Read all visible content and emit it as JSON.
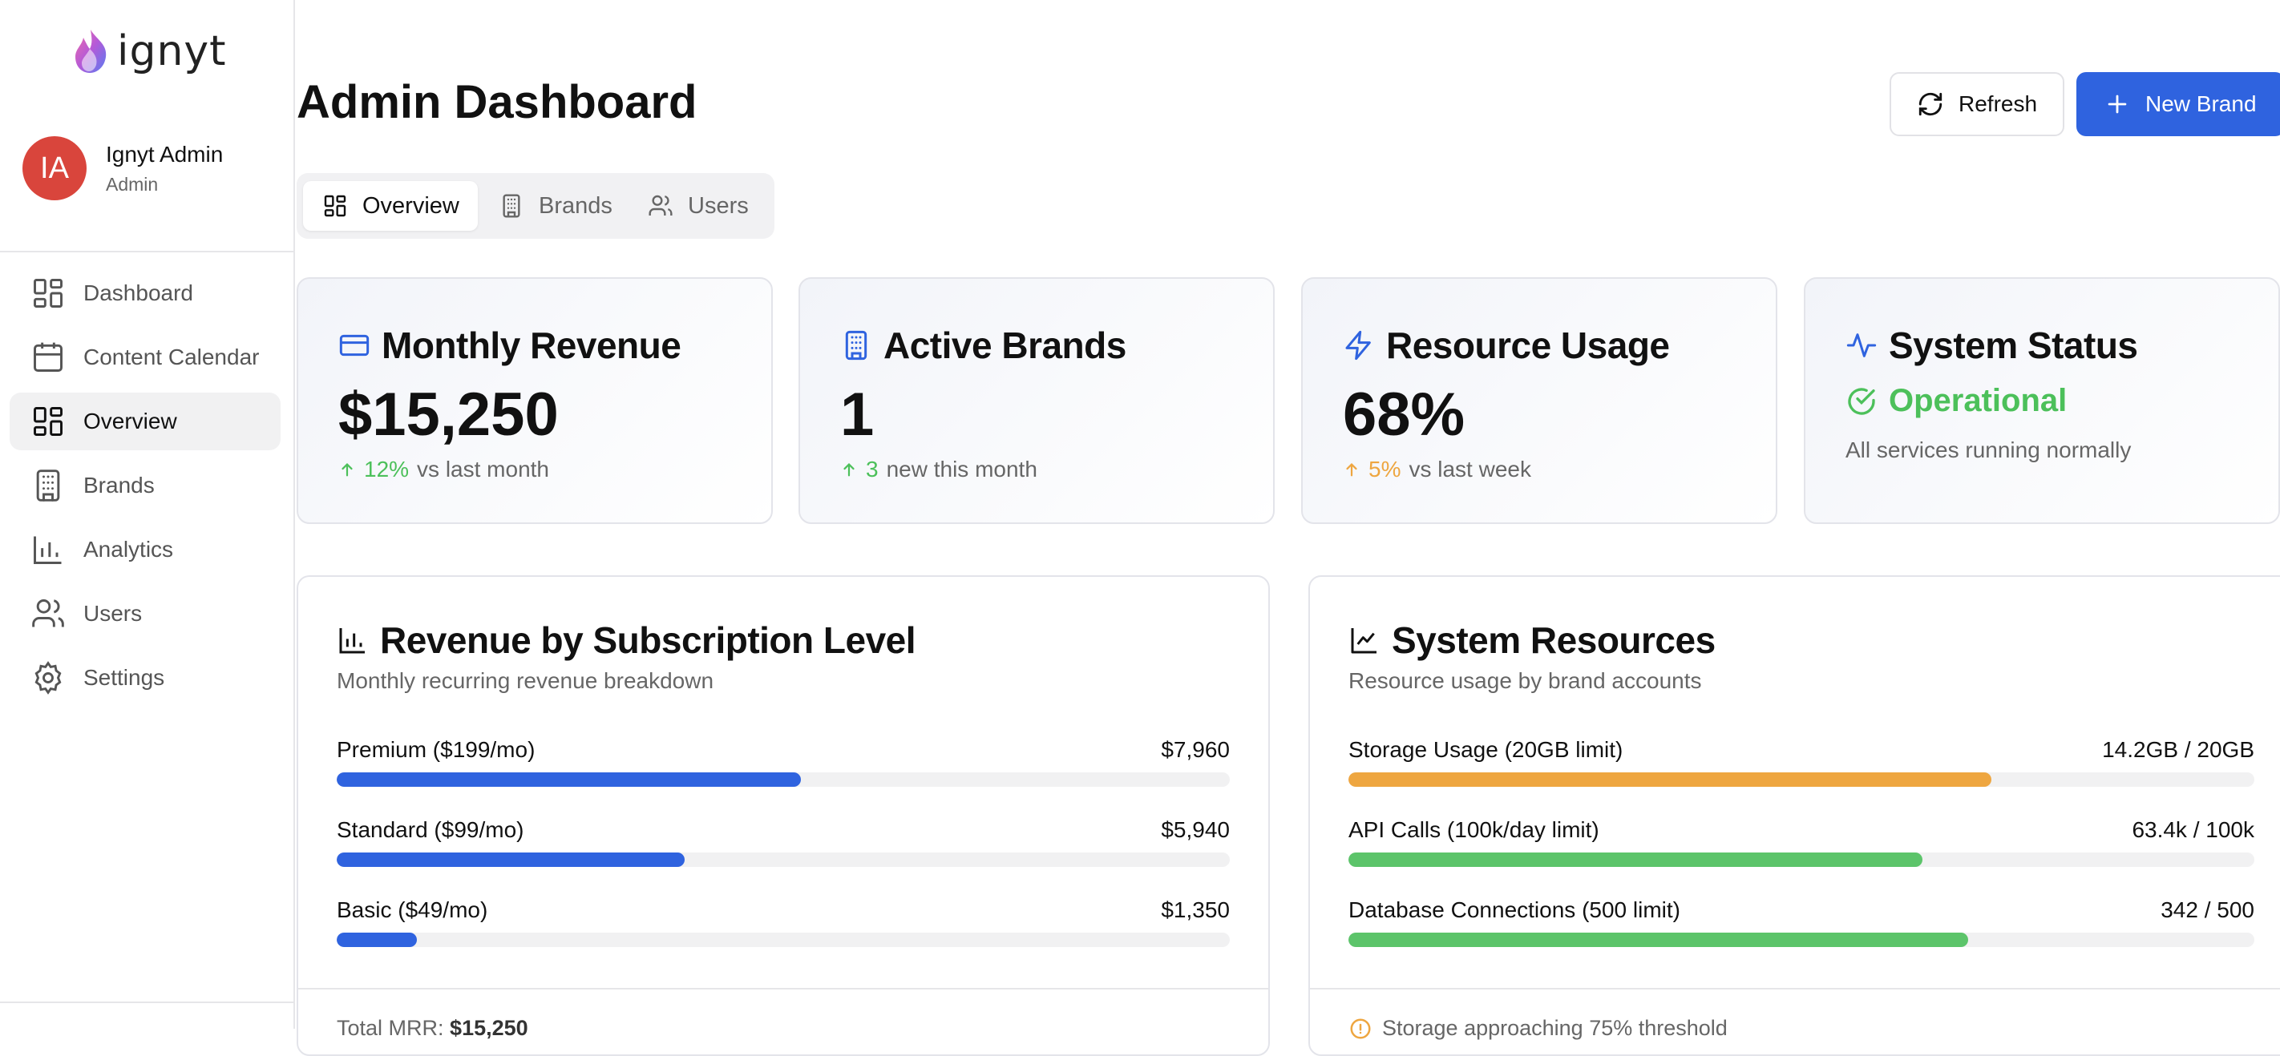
{
  "brand": {
    "name": "ignyt"
  },
  "user": {
    "initials": "IA",
    "name": "Ignyt Admin",
    "role": "Admin"
  },
  "nav": [
    {
      "label": "Dashboard",
      "icon": "dashboard-icon",
      "active": false
    },
    {
      "label": "Content Calendar",
      "icon": "calendar-icon",
      "active": false
    },
    {
      "label": "Overview",
      "icon": "dashboard-icon",
      "active": true
    },
    {
      "label": "Brands",
      "icon": "building-icon",
      "active": false
    },
    {
      "label": "Analytics",
      "icon": "bar-chart-icon",
      "active": false
    },
    {
      "label": "Users",
      "icon": "users-icon",
      "active": false
    },
    {
      "label": "Settings",
      "icon": "gear-icon",
      "active": false
    }
  ],
  "page": {
    "title": "Admin Dashboard"
  },
  "actions": {
    "refresh": "Refresh",
    "new_brand": "New Brand"
  },
  "tabs": [
    {
      "label": "Overview",
      "active": true
    },
    {
      "label": "Brands",
      "active": false
    },
    {
      "label": "Users",
      "active": false
    }
  ],
  "stats": {
    "revenue": {
      "title": "Monthly Revenue",
      "value": "$15,250",
      "change": "12%",
      "change_suffix": "vs last month"
    },
    "brands": {
      "title": "Active Brands",
      "value": "1",
      "change": "3",
      "change_suffix": "new this month"
    },
    "usage": {
      "title": "Resource Usage",
      "value": "68%",
      "change": "5%",
      "change_suffix": "vs last week"
    },
    "status": {
      "title": "System Status",
      "state": "Operational",
      "detail": "All services running normally"
    }
  },
  "revenue_panel": {
    "title": "Revenue by Subscription Level",
    "subtitle": "Monthly recurring revenue breakdown",
    "rows": [
      {
        "label": "Premium ($199/mo)",
        "amount": "$7,960",
        "fraction": 0.52
      },
      {
        "label": "Standard ($99/mo)",
        "amount": "$5,940",
        "fraction": 0.39
      },
      {
        "label": "Basic ($49/mo)",
        "amount": "$1,350",
        "fraction": 0.09
      }
    ],
    "footer_label": "Total MRR:",
    "footer_value": "$15,250"
  },
  "resources_panel": {
    "title": "System Resources",
    "subtitle": "Resource usage by brand accounts",
    "rows": [
      {
        "label": "Storage Usage (20GB limit)",
        "amount": "14.2GB / 20GB",
        "fraction": 0.71
      },
      {
        "label": "API Calls (100k/day limit)",
        "amount": "63.4k / 100k",
        "fraction": 0.634
      },
      {
        "label": "Database Connections (500 limit)",
        "amount": "342 / 500",
        "fraction": 0.684
      }
    ],
    "footer_label": "Storage approaching 75% threshold"
  },
  "colors": {
    "accent": "#2f63df",
    "green": "#5cc46a",
    "orange": "#eea640",
    "status_green": "#4cc05a",
    "avatar": "#d9453c"
  }
}
